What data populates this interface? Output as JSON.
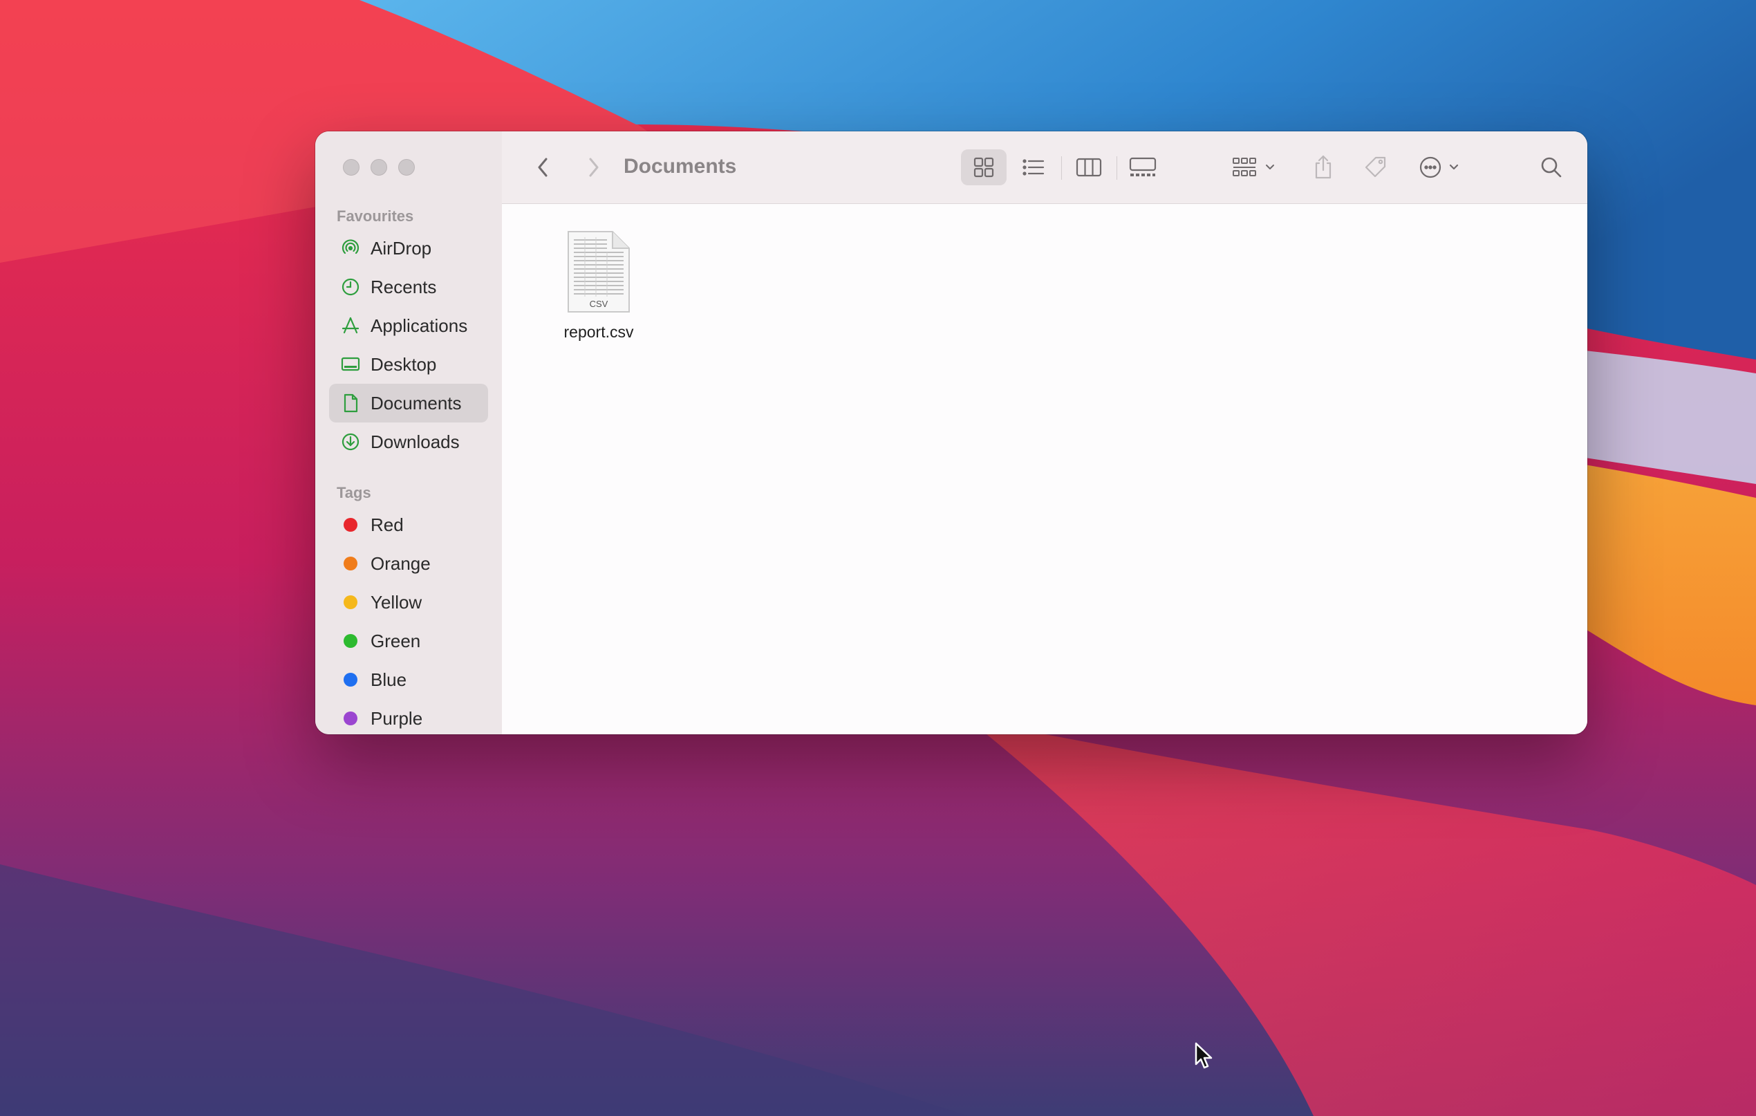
{
  "window": {
    "title": "Documents"
  },
  "sidebar": {
    "favourites_title": "Favourites",
    "favourites": [
      {
        "label": "AirDrop",
        "icon": "airdrop-icon"
      },
      {
        "label": "Recents",
        "icon": "clock-icon"
      },
      {
        "label": "Applications",
        "icon": "applications-icon"
      },
      {
        "label": "Desktop",
        "icon": "desktop-icon"
      },
      {
        "label": "Documents",
        "icon": "document-icon",
        "selected": true
      },
      {
        "label": "Downloads",
        "icon": "download-icon"
      }
    ],
    "tags_title": "Tags",
    "tags": [
      {
        "label": "Red",
        "color": "#e8262c"
      },
      {
        "label": "Orange",
        "color": "#f07c1a"
      },
      {
        "label": "Yellow",
        "color": "#f5b81b"
      },
      {
        "label": "Green",
        "color": "#2dba2f"
      },
      {
        "label": "Blue",
        "color": "#1f6ff0"
      },
      {
        "label": "Purple",
        "color": "#9b45d0"
      }
    ]
  },
  "toolbar": {
    "view_mode_selected": "icons",
    "icons": [
      "back-icon",
      "forward-icon",
      "icon-view-icon",
      "list-view-icon",
      "column-view-icon",
      "gallery-view-icon",
      "group-icon",
      "share-icon",
      "tag-icon",
      "more-icon",
      "search-icon"
    ]
  },
  "files": [
    {
      "name": "report.csv",
      "badge": "CSV"
    }
  ],
  "colors": {
    "accent_green": "#2e9e3e"
  }
}
